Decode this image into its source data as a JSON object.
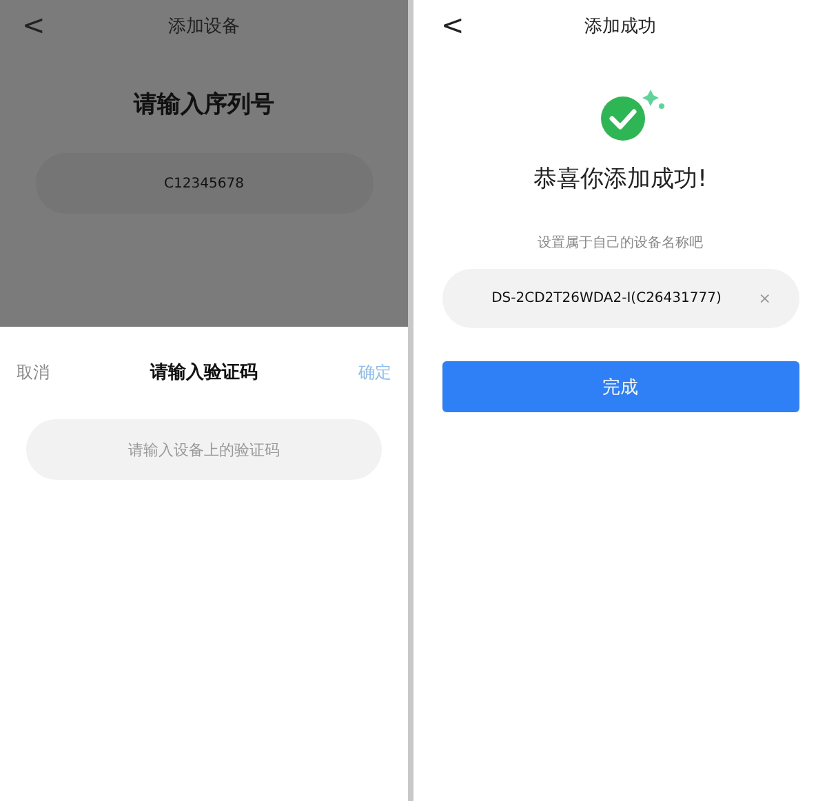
{
  "add_device_screen": {
    "back": "<",
    "title": "添加设备",
    "heading": "请输入序列号",
    "serial_field": {
      "value": "C12345678"
    },
    "dimmed": true
  },
  "verify_sheet": {
    "cancel": "取消",
    "title": "请输入验证码",
    "confirm": "确定",
    "code_field": {
      "placeholder": "请输入设备上的验证码"
    }
  },
  "success_screen": {
    "back": "<",
    "title": "添加成功",
    "heading": "恭喜你添加成功!",
    "hint": "设置属于自己的设备名称吧",
    "name_field": {
      "value": "DS-2CD2T26WDA2-I(C26431777)",
      "clear": "×"
    },
    "done_button": "完成"
  }
}
